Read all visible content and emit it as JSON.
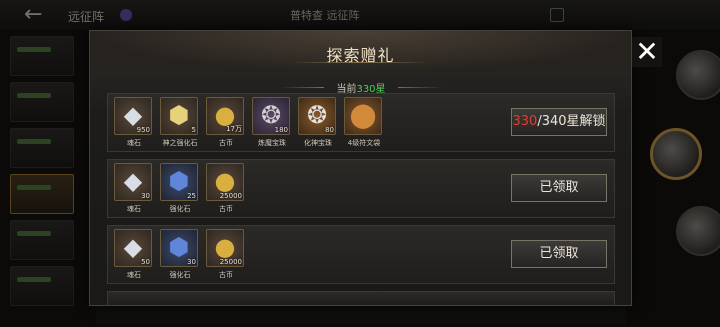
{
  "background": {
    "title": "远征阵",
    "center_text": "普特查 远征阵"
  },
  "modal": {
    "title": "探索赠礼",
    "stars_label": "当前",
    "stars_value": "330星",
    "close_icon": "close-icon"
  },
  "rows": [
    {
      "items": [
        {
          "name": "魂石",
          "qty": "950",
          "icon": "diamond-gem-icon",
          "color": "brown"
        },
        {
          "name": "神之强化石",
          "qty": "5",
          "icon": "gold-stone-icon",
          "color": "brown"
        },
        {
          "name": "古币",
          "qty": "17万",
          "icon": "gold-coins-icon",
          "color": "brown"
        },
        {
          "name": "炼魔宝珠",
          "qty": "180",
          "icon": "silver-orb-icon",
          "color": "purple"
        },
        {
          "name": "化神宝珠",
          "qty": "80",
          "icon": "silver-orb-pile-icon",
          "color": "orange"
        },
        {
          "name": "4级符文袋",
          "qty": "",
          "icon": "rune-bag-icon",
          "color": "orange"
        }
      ],
      "button": {
        "current": "330",
        "rest": "/340星解锁"
      }
    },
    {
      "items": [
        {
          "name": "魂石",
          "qty": "30",
          "icon": "diamond-gem-icon",
          "color": "brown"
        },
        {
          "name": "强化石",
          "qty": "25",
          "icon": "blue-stone-icon",
          "color": "blue"
        },
        {
          "name": "古币",
          "qty": "25000",
          "icon": "gold-coins-icon",
          "color": "brown"
        }
      ],
      "button": {
        "label": "已领取"
      }
    },
    {
      "items": [
        {
          "name": "魂石",
          "qty": "50",
          "icon": "diamond-gem-icon",
          "color": "brown"
        },
        {
          "name": "强化石",
          "qty": "30",
          "icon": "blue-stone-icon",
          "color": "blue"
        },
        {
          "name": "古币",
          "qty": "25000",
          "icon": "gold-coins-icon",
          "color": "brown"
        }
      ],
      "button": {
        "label": "已领取"
      }
    }
  ],
  "colors": {
    "accent_red": "#e23b2e",
    "accent_green": "#4fd24f",
    "gold_border": "#c79a48"
  }
}
